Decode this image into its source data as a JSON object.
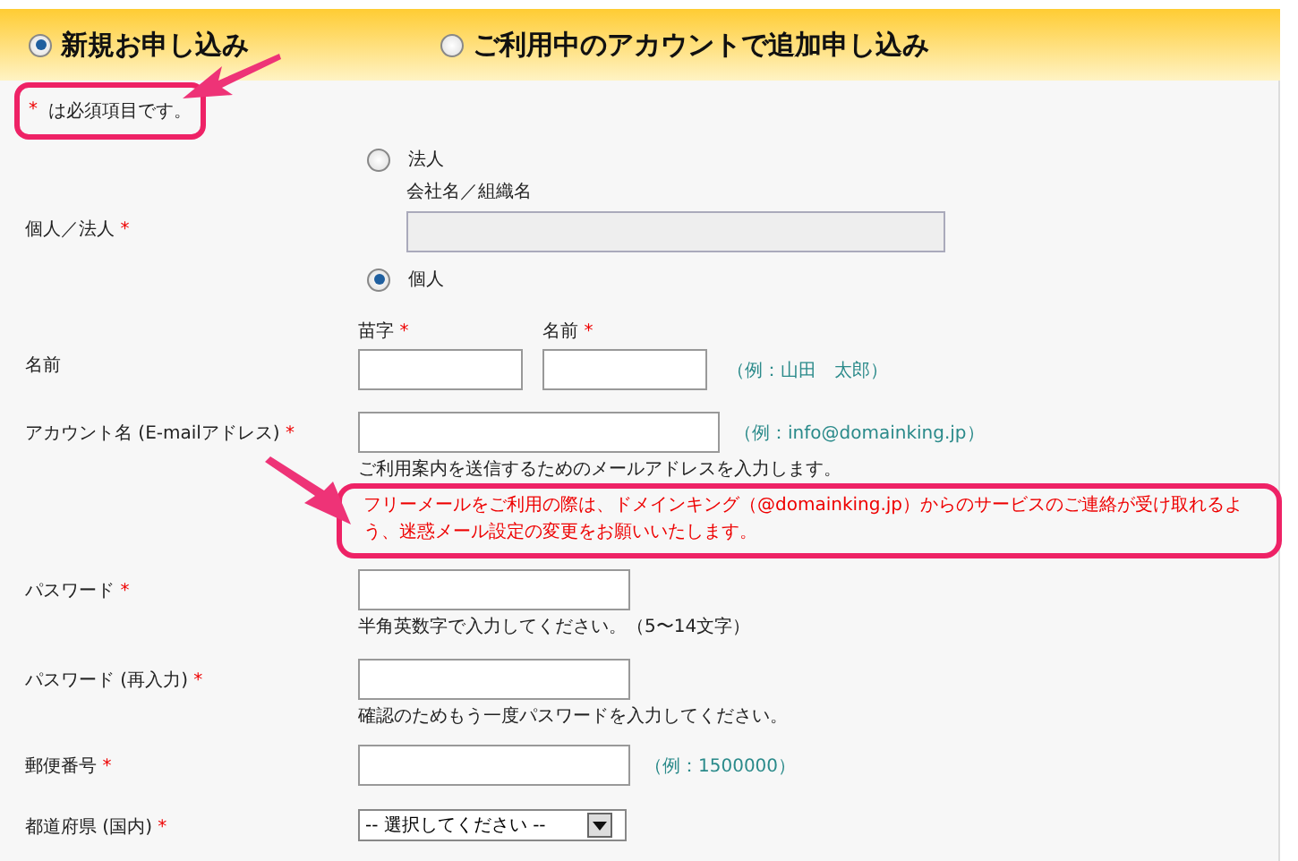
{
  "tabs": [
    {
      "label": "新規お申し込み",
      "selected": true
    },
    {
      "label": "ご利用中のアカウントで追加申し込み",
      "selected": false
    }
  ],
  "required_note": {
    "mark": "*",
    "text": "は必須項目です。",
    "highlighted": true
  },
  "fields": [
    {
      "kind": "entity",
      "label": "個人／法人",
      "required": true,
      "options": [
        {
          "label": "法人",
          "selected": false
        },
        {
          "label": "個人",
          "selected": true
        }
      ],
      "company_field": {
        "label": "会社名／組織名",
        "disabled": true
      }
    },
    {
      "kind": "name",
      "label": "名前",
      "required": false,
      "parts": [
        {
          "label": "苗字",
          "required": true
        },
        {
          "label": "名前",
          "required": true
        }
      ],
      "example": "（例：山田　太郎）"
    },
    {
      "kind": "email",
      "label": "アカウント名 (E-mailアドレス)",
      "required": true,
      "example": "（例：info@domainking.jp）",
      "notes": [
        {
          "kind": "plain",
          "text": "ご利用案内を送信するためのメールアドレスを入力します。"
        },
        {
          "kind": "warning",
          "text": "フリーメールをご利用の際は、ドメインキング（@domainking.jp）からのサービスのご連絡が受け取れるよう、迷惑メール設定の変更をお願いいたします。",
          "highlighted": true
        }
      ]
    },
    {
      "kind": "password",
      "label": "パスワード",
      "required": true,
      "notes": [
        {
          "kind": "plain",
          "text": "半角英数字で入力してください。（5〜14文字）"
        }
      ]
    },
    {
      "kind": "password",
      "label": "パスワード (再入力)",
      "required": true,
      "notes": [
        {
          "kind": "plain",
          "text": "確認のためもう一度パスワードを入力してください。"
        }
      ]
    },
    {
      "kind": "postal",
      "label": "郵便番号",
      "required": true,
      "example": "（例：1500000）"
    },
    {
      "kind": "select",
      "label": "都道府県 (国内)",
      "required": true,
      "value": "-- 選択してください --"
    }
  ]
}
